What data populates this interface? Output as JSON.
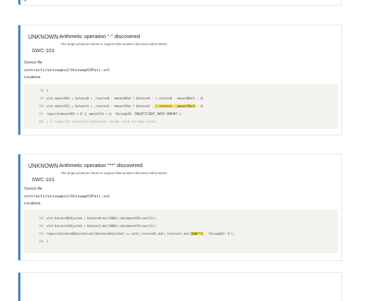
{
  "issues": [
    {
      "severity": "UNKNOWN",
      "swc": "SWC-101",
      "title": "Arithmetic operation \"-\" discovered",
      "description": "This plugin produces issues to support false positive discovery within MythX.",
      "source_label": "Source file",
      "source_path": "contracts/uniswapv2/UniswapV2Pair.sol",
      "locations_label": "Locations",
      "lines": [
        {
          "n": "98",
          "text": "}"
        },
        {
          "n": "99",
          "text": "uint amount0In = balance0 > _reserve0 - amount0Out ? balance0 - (_reserve0 - amount0Out) : 0;"
        },
        {
          "n": "100",
          "pre": "uint amount1In = balance1 > _reserve1 - amount1Out ? balance1 - ",
          "hl": "(_reserve1 - amount1Out)",
          "post": " : 0;"
        },
        {
          "n": "101",
          "text": "require(amount0In > 0 || amount1In > 0, 'UniswapV2: INSUFFICIENT_INPUT_AMOUNT');"
        },
        {
          "n": "102",
          "text": "{ // scope for reserve{0,1}Adjusted, avoids stack too deep errors"
        }
      ]
    },
    {
      "severity": "UNKNOWN",
      "swc": "SWC-101",
      "title": "Arithmetic operation \"**\" discovered",
      "description": "This plugin produces issues to support false positive discovery within MythX.",
      "source_label": "Source file",
      "source_path": "contracts/uniswapv2/UniswapV2Pair.sol",
      "locations_label": "Locations",
      "lines": [
        {
          "n": "103",
          "text": "uint balance0Adjusted = balance0.mul(1000).sub(amount0In.mul(3));"
        },
        {
          "n": "104",
          "text": "uint balance1Adjusted = balance1.mul(1000).sub(amount1In.mul(3));"
        },
        {
          "n": "105",
          "pre": "require(balance0Adjusted.mul(balance1Adjusted) >= uint(_reserve0).mul(_reserve1).mul(",
          "hl": "1000**2",
          "post": "), 'UniswapV2: K');"
        },
        {
          "n": "106",
          "text": "}"
        }
      ]
    }
  ]
}
